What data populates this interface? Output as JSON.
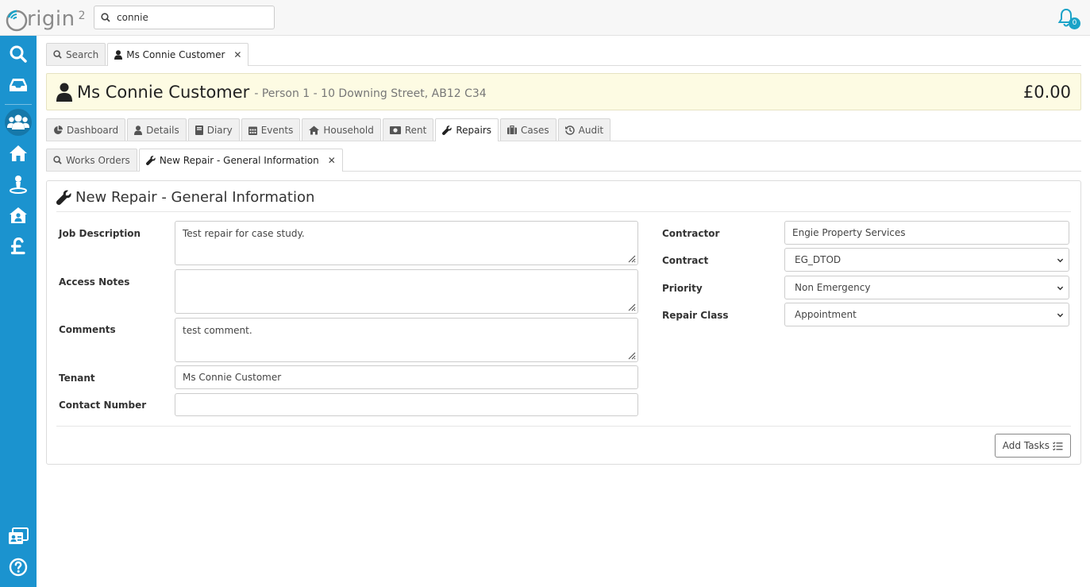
{
  "app": {
    "logo_text": "rigin",
    "logo_sup": "2"
  },
  "search": {
    "value": "connie"
  },
  "notifications": {
    "count": "0"
  },
  "top_tabs": [
    {
      "label": "Search",
      "icon": "search-icon"
    },
    {
      "label": "Ms Connie Customer",
      "icon": "user-icon",
      "closable": true
    }
  ],
  "customer": {
    "name": "Ms Connie Customer",
    "subtitle": "- Person 1  - 10 Downing Street, AB12 C34",
    "balance": "£0.00"
  },
  "section_tabs": [
    {
      "label": "Dashboard",
      "icon": "pie-chart-icon"
    },
    {
      "label": "Details",
      "icon": "user-icon"
    },
    {
      "label": "Diary",
      "icon": "book-icon"
    },
    {
      "label": "Events",
      "icon": "calendar-icon"
    },
    {
      "label": "Household",
      "icon": "home-icon"
    },
    {
      "label": "Rent",
      "icon": "money-icon"
    },
    {
      "label": "Repairs",
      "icon": "wrench-icon",
      "active": true
    },
    {
      "label": "Cases",
      "icon": "briefcase-icon"
    },
    {
      "label": "Audit",
      "icon": "history-icon"
    }
  ],
  "sub_tabs": [
    {
      "label": "Works Orders",
      "icon": "search-icon"
    },
    {
      "label": "New Repair - General Information",
      "icon": "wrench-icon",
      "closable": true
    }
  ],
  "form": {
    "title": "New Repair - General Information",
    "job_description": {
      "label": "Job Description",
      "value": "Test repair for case study."
    },
    "access_notes": {
      "label": "Access Notes",
      "value": ""
    },
    "comments": {
      "label": "Comments",
      "value": "test comment."
    },
    "tenant": {
      "label": "Tenant",
      "value": "Ms Connie Customer"
    },
    "contact_number": {
      "label": "Contact Number",
      "value": ""
    },
    "contractor": {
      "label": "Contractor",
      "value": "Engie Property Services"
    },
    "contract": {
      "label": "Contract",
      "value": "EG_DTOD"
    },
    "priority": {
      "label": "Priority",
      "value": "Non Emergency"
    },
    "repair_class": {
      "label": "Repair Class",
      "value": "Appointment"
    },
    "add_tasks_label": "Add Tasks"
  },
  "colors": {
    "sidebar": "#1b93cf",
    "banner": "#fdfbe3",
    "accent": "#1aa3c8"
  }
}
